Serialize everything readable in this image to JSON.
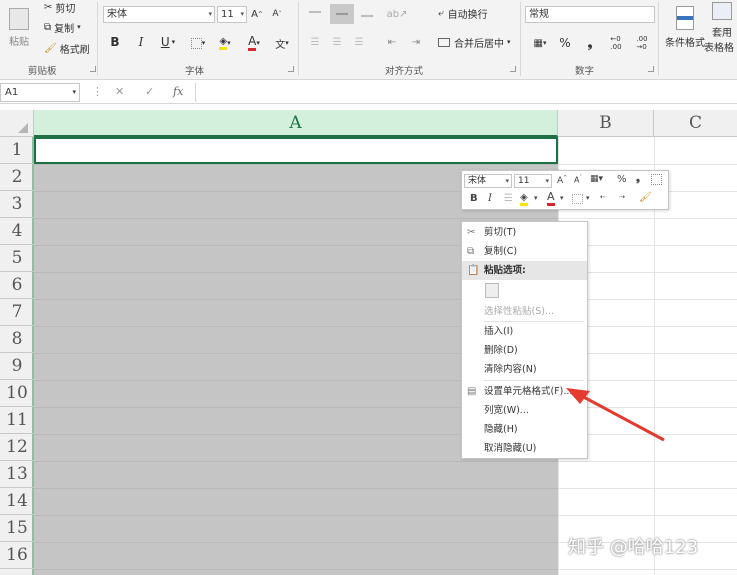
{
  "ribbon": {
    "clipboard": {
      "paste": "粘贴",
      "cut": "剪切",
      "copy": "复制",
      "format_painter": "格式刷",
      "label": "剪贴板"
    },
    "font": {
      "name": "宋体",
      "size": "11",
      "bold": "B",
      "italic": "I",
      "underline": "U",
      "color_a": "A",
      "phonetic": "文",
      "label": "字体"
    },
    "alignment": {
      "wrap": "自动换行",
      "merge": "合并后居中",
      "label": "对齐方式"
    },
    "number": {
      "format": "常规",
      "percent": "%",
      "comma": "❟",
      "label": "数字"
    },
    "styles": {
      "conditional": "条件格式",
      "table": "套用",
      "table2": "表格格"
    }
  },
  "formula_bar": {
    "name_box": "A1",
    "cancel": "✕",
    "enter": "✓",
    "fx": "fx",
    "dots": "⋮"
  },
  "columns": [
    "A",
    "B",
    "C"
  ],
  "rows": [
    "1",
    "2",
    "3",
    "4",
    "5",
    "6",
    "7",
    "8",
    "9",
    "10",
    "11",
    "12",
    "13",
    "14",
    "15",
    "16"
  ],
  "mini_toolbar": {
    "font": "宋体",
    "size": "11",
    "bold": "B",
    "italic": "I",
    "percent": "%",
    "comma": "❟"
  },
  "context_menu": {
    "cut": "剪切(T)",
    "copy": "复制(C)",
    "paste_options": "粘贴选项:",
    "paste_special": "选择性粘贴(S)...",
    "insert": "插入(I)",
    "delete": "删除(D)",
    "clear": "清除内容(N)",
    "format_cells": "设置单元格格式(F)...",
    "col_width": "列宽(W)...",
    "hide": "隐藏(H)",
    "unhide": "取消隐藏(U)"
  },
  "watermark": "知乎 @哈哈123",
  "colors": {
    "accent": "#1e7145",
    "arrow": "#e53a2f",
    "selection": "#c5c5c5"
  }
}
